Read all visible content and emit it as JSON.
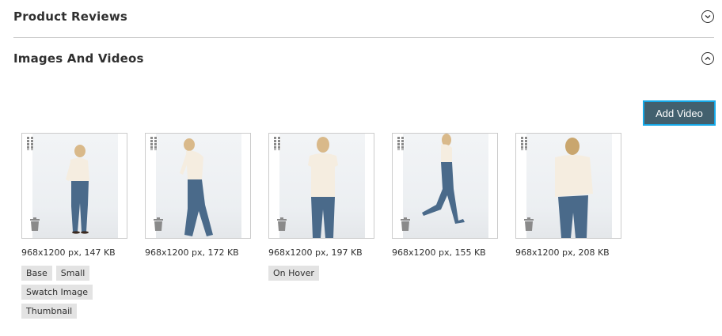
{
  "sections": {
    "reviews": {
      "title": "Product Reviews",
      "toggle_icon": "chevron-down-circle-icon"
    },
    "images": {
      "title": "Images And Videos",
      "toggle_icon": "chevron-up-circle-icon"
    }
  },
  "add_video_label": "Add Video",
  "colors": {
    "accent_button": "#42606e",
    "button_focus_border": "#16a9e8",
    "tag_background": "#e3e3e3"
  },
  "images": [
    {
      "meta": "968x1200 px, 147 KB",
      "roles": [
        "Base",
        "Small",
        "Swatch Image",
        "Thumbnail"
      ]
    },
    {
      "meta": "968x1200 px, 172 KB",
      "roles": []
    },
    {
      "meta": "968x1200 px, 197 KB",
      "roles": [
        "On Hover"
      ]
    },
    {
      "meta": "968x1200 px, 155 KB",
      "roles": []
    },
    {
      "meta": "968x1200 px, 208 KB",
      "roles": []
    }
  ]
}
